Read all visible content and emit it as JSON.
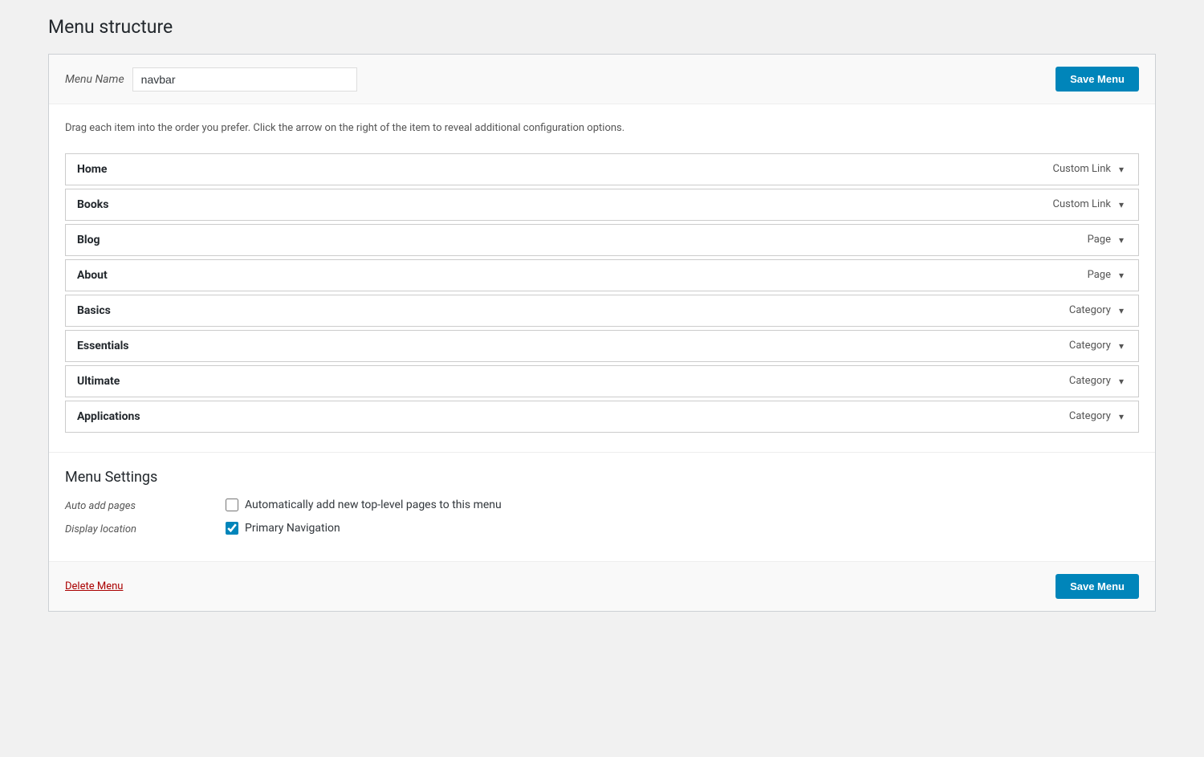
{
  "page": {
    "title": "Menu structure"
  },
  "menu_name_label": "Menu Name",
  "menu_name_value": "navbar",
  "save_menu_label": "Save Menu",
  "instructions": "Drag each item into the order you prefer. Click the arrow on the right of the item to reveal additional configuration options.",
  "menu_items": [
    {
      "id": 1,
      "name": "Home",
      "type": "Custom Link"
    },
    {
      "id": 2,
      "name": "Books",
      "type": "Custom Link"
    },
    {
      "id": 3,
      "name": "Blog",
      "type": "Page"
    },
    {
      "id": 4,
      "name": "About",
      "type": "Page"
    },
    {
      "id": 5,
      "name": "Basics",
      "type": "Category"
    },
    {
      "id": 6,
      "name": "Essentials",
      "type": "Category"
    },
    {
      "id": 7,
      "name": "Ultimate",
      "type": "Category"
    },
    {
      "id": 8,
      "name": "Applications",
      "type": "Category"
    }
  ],
  "menu_settings": {
    "title": "Menu Settings",
    "auto_add_pages_label": "Auto add pages",
    "auto_add_pages_text": "Automatically add new top-level pages to this menu",
    "auto_add_pages_checked": false,
    "display_location_label": "Display location",
    "display_location_text": "Primary Navigation",
    "display_location_checked": true
  },
  "delete_menu_label": "Delete Menu"
}
